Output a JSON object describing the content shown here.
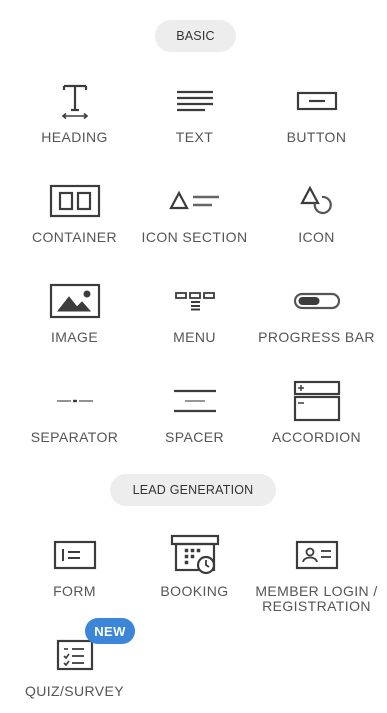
{
  "sections": {
    "basic_label": "BASIC",
    "lead_label": "LEAD GENERATION"
  },
  "widgets": {
    "heading": {
      "label": "HEADING",
      "icon": "heading-icon"
    },
    "text": {
      "label": "TEXT",
      "icon": "text-icon"
    },
    "button": {
      "label": "BUTTON",
      "icon": "button-icon"
    },
    "container": {
      "label": "CONTAINER",
      "icon": "container-icon"
    },
    "icon_section": {
      "label": "ICON SECTION",
      "icon": "icon-section-icon"
    },
    "icon": {
      "label": "ICON",
      "icon": "shapes-icon"
    },
    "image": {
      "label": "IMAGE",
      "icon": "image-icon"
    },
    "menu": {
      "label": "MENU",
      "icon": "menu-icon"
    },
    "progress_bar": {
      "label": "PROGRESS BAR",
      "icon": "progress-bar-icon"
    },
    "separator": {
      "label": "SEPARATOR",
      "icon": "separator-icon"
    },
    "spacer": {
      "label": "SPACER",
      "icon": "spacer-icon"
    },
    "accordion": {
      "label": "ACCORDION",
      "icon": "accordion-icon"
    },
    "form": {
      "label": "FORM",
      "icon": "form-icon"
    },
    "booking": {
      "label": "BOOKING",
      "icon": "booking-icon"
    },
    "member_login": {
      "label_line1": "MEMBER LOGIN /",
      "label_line2": "REGISTRATION",
      "icon": "member-card-icon"
    },
    "quiz": {
      "label": "QUIZ/SURVEY",
      "icon": "quiz-icon",
      "badge": "NEW"
    }
  },
  "colors": {
    "badge": "#3b86d8",
    "pill": "#ededed",
    "icon": "#3c3c3c",
    "label": "#555555"
  }
}
